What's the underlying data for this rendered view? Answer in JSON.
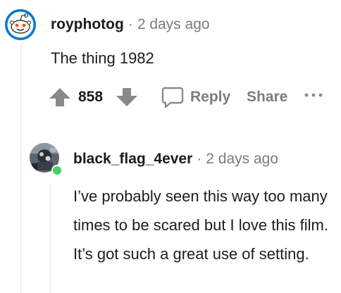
{
  "comment": {
    "username": "royphotog",
    "separator": "·",
    "time": "2 days ago",
    "text": "The thing 1982",
    "score": "858",
    "actions": {
      "reply_label": "Reply",
      "share_label": "Share"
    },
    "avatar_icon": "reddit-snoo-avatar-icon"
  },
  "reply": {
    "username": "black_flag_4ever",
    "separator": "·",
    "time": "2 days ago",
    "text": "I’ve probably seen this way too many times to be scared but I love this film. It’s got such a great use of setting.",
    "online_status_color": "#46d160",
    "avatar_icon": "user-photo-avatar-icon"
  },
  "colors": {
    "muted": "#7c7c7c",
    "text": "#1c1c1c",
    "thread_line": "#edeff1",
    "snoo_blue": "#0079d3"
  }
}
